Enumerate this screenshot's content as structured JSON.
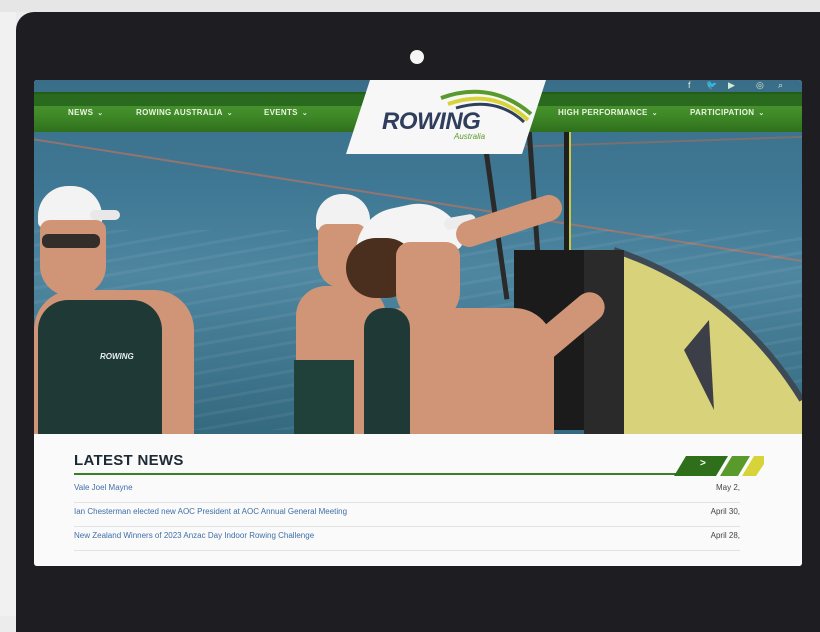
{
  "nav": {
    "items": [
      {
        "label": "NEWS",
        "caret": "⌄"
      },
      {
        "label": "ROWING AUSTRALIA",
        "caret": "⌄"
      },
      {
        "label": "EVENTS",
        "caret": "⌄"
      },
      {
        "label": "HIGH PERFORMANCE",
        "caret": "⌄"
      },
      {
        "label": "PARTICIPATION",
        "caret": "⌄"
      }
    ],
    "social_icons": [
      "facebook-icon",
      "twitter-icon",
      "youtube-icon",
      "instagram-icon",
      "search-icon"
    ],
    "social_glyphs": [
      "f",
      "🐦",
      "▶",
      "◎",
      "⌕"
    ]
  },
  "logo": {
    "name": "ROWING",
    "sub": "Australia"
  },
  "hero": {
    "singlet_text": "ROWING"
  },
  "news": {
    "heading": "LATEST NEWS",
    "more_label": ">",
    "items": [
      {
        "title": "Vale Joel Mayne",
        "date": "May 2,"
      },
      {
        "title": "Ian Chesterman elected new AOC President at AOC Annual General Meeting",
        "date": "April 30,"
      },
      {
        "title": "New Zealand Winners of 2023 Anzac Day Indoor Rowing Challenge",
        "date": "April 28,"
      }
    ]
  },
  "colors": {
    "brand_green": "#3f8a28",
    "brand_navy": "#2f3e5c",
    "accent_yellow": "#d7d43a",
    "bezel": "#1e1e22"
  }
}
